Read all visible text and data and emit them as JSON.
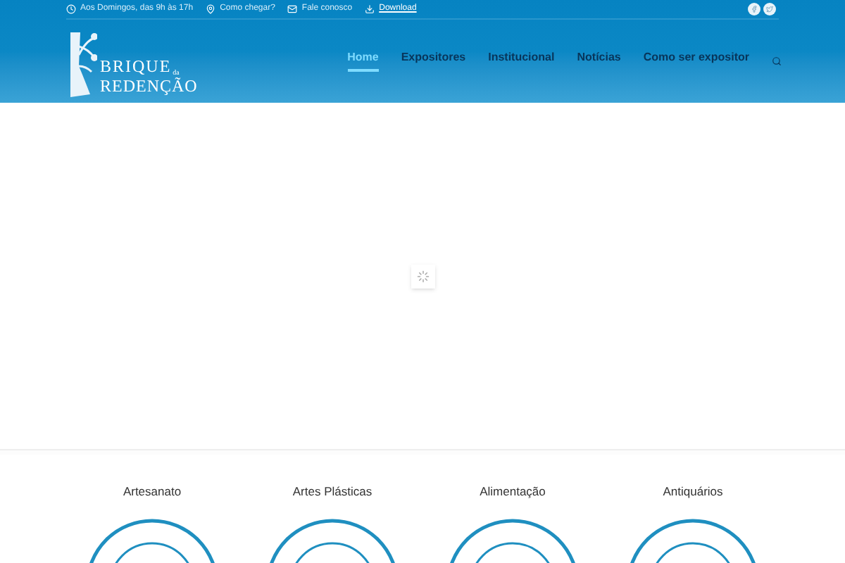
{
  "topbar": {
    "items": [
      {
        "kind": "clock",
        "text": "Aos Domingos, das 9h às 17h"
      },
      {
        "kind": "pin",
        "text": "Como chegar?"
      },
      {
        "kind": "mail",
        "text": "Fale conosco"
      },
      {
        "kind": "download",
        "text": "Download"
      }
    ]
  },
  "logo": {
    "line1": "BRIQUE",
    "small": "da",
    "line2": "REDENÇÃO"
  },
  "nav": [
    {
      "label": "Home",
      "selected": true
    },
    {
      "label": "Expositores",
      "selected": false
    },
    {
      "label": "Institucional",
      "selected": false
    },
    {
      "label": "Notícias",
      "selected": false
    },
    {
      "label": "Como ser expositor",
      "selected": false
    }
  ],
  "categories": [
    {
      "title": "Artesanato"
    },
    {
      "title": "Artes Plásticas"
    },
    {
      "title": "Alimentação"
    },
    {
      "title": "Antiquários"
    }
  ]
}
